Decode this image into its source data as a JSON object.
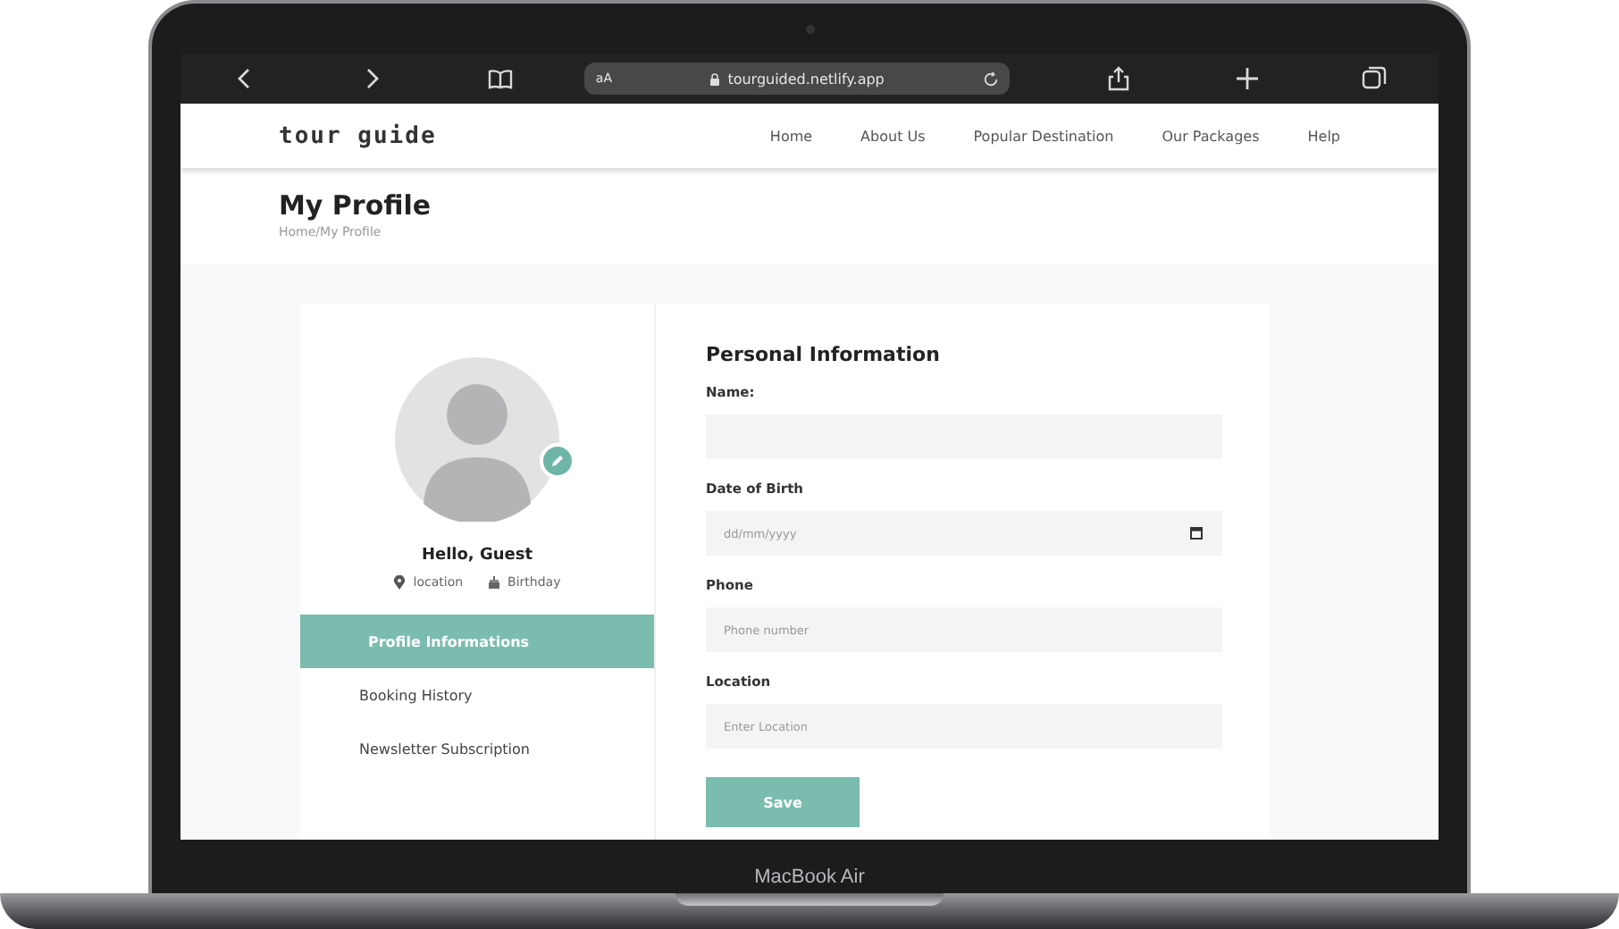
{
  "browser": {
    "reader_label": "aA",
    "url": "tourguided.netlify.app"
  },
  "site": {
    "logo": "tour guide",
    "nav": [
      "Home",
      "About Us",
      "Popular Destination",
      "Our Packages",
      "Help"
    ]
  },
  "page": {
    "title": "My Profile",
    "breadcrumb": "Home/My Profile"
  },
  "profile": {
    "greeting": "Hello, Guest",
    "location": "location",
    "birthday": "Birthday"
  },
  "sidebar": {
    "items": [
      {
        "label": "Profile Informations",
        "selected": true
      },
      {
        "label": "Booking History",
        "selected": false
      },
      {
        "label": "Newsletter Subscription",
        "selected": false
      }
    ]
  },
  "form": {
    "title": "Personal Information",
    "fields": [
      {
        "label": "Name:",
        "kind": "text"
      },
      {
        "label": "Date of Birth",
        "kind": "date",
        "placeholder": "dd/mm/yyyy"
      },
      {
        "label": "Phone",
        "kind": "text",
        "placeholder": "Phone number"
      },
      {
        "label": "Location",
        "kind": "text",
        "placeholder": "Enter Location"
      }
    ],
    "save_button": "Save"
  },
  "device": {
    "model": "MacBook Air"
  }
}
